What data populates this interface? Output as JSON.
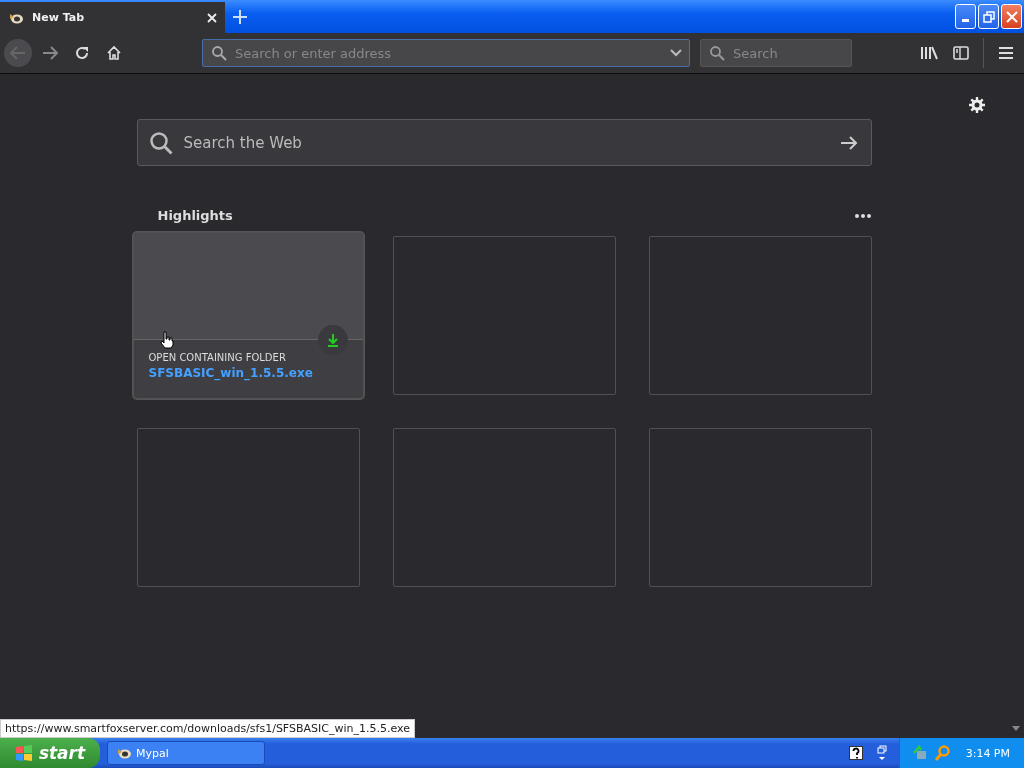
{
  "tabs": [
    {
      "title": "New Tab",
      "selected": true
    }
  ],
  "toolbar": {
    "address_placeholder": "Search or enter address",
    "search_placeholder": "Search"
  },
  "page": {
    "search_placeholder": "Search the Web",
    "highlights_title": "Highlights",
    "cards": [
      {
        "kind": "download",
        "hovered": true,
        "context": "OPEN CONTAINING FOLDER",
        "title": "SFSBASIC_win_1.5.5.exe"
      },
      {
        "kind": "empty"
      },
      {
        "kind": "empty"
      },
      {
        "kind": "empty"
      },
      {
        "kind": "empty"
      },
      {
        "kind": "empty"
      }
    ]
  },
  "status_url": "https://www.smartfoxserver.com/downloads/sfs1/SFSBASIC_win_1.5.5.exe",
  "taskbar": {
    "start": "start",
    "tasks": [
      {
        "label": "Mypal",
        "selected": false
      }
    ],
    "clock": "3:14 PM"
  }
}
